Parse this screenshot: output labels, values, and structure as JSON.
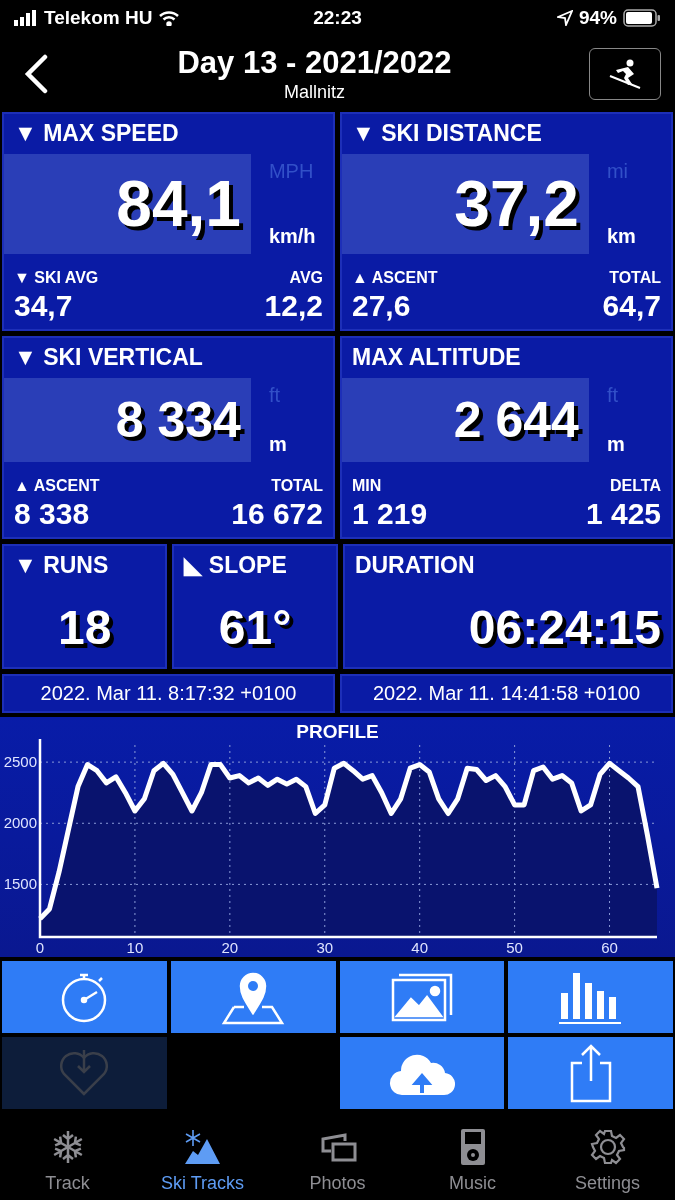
{
  "status_bar": {
    "carrier": "Telekom HU",
    "time": "22:23",
    "battery": "94%"
  },
  "header": {
    "title": "Day 13 - 2021/2022",
    "subtitle": "Mallnitz"
  },
  "stat_rows": [
    {
      "panels": [
        {
          "kind": "big",
          "title": "▼ MAX SPEED",
          "value": "84,1",
          "alt_unit": "MPH",
          "unit": "km/h",
          "sub_left_label": "▼ SKI AVG",
          "sub_right_label": "AVG",
          "sub_left_value": "34,7",
          "sub_right_value": "12,2"
        },
        {
          "kind": "big",
          "title": "▼ SKI DISTANCE",
          "value": "37,2",
          "alt_unit": "mi",
          "unit": "km",
          "sub_left_label": "▲ ASCENT",
          "sub_right_label": "TOTAL",
          "sub_left_value": "27,6",
          "sub_right_value": "64,7"
        }
      ]
    },
    {
      "panels": [
        {
          "kind": "big",
          "title": "▼ SKI VERTICAL",
          "value": "8 334",
          "alt_unit": "ft",
          "unit": "m",
          "sub_left_label": "▲ ASCENT",
          "sub_right_label": "TOTAL",
          "sub_left_value": "8 338",
          "sub_right_value": "16 672"
        },
        {
          "kind": "big",
          "title": "MAX ALTITUDE",
          "value": "2 644",
          "alt_unit": "ft",
          "unit": "m",
          "sub_left_label": "MIN",
          "sub_right_label": "DELTA",
          "sub_left_value": "1 219",
          "sub_right_value": "1 425"
        }
      ]
    },
    {
      "panels": [
        {
          "kind": "center",
          "title": "▼ RUNS",
          "value": "18"
        },
        {
          "kind": "center",
          "title": "◣ SLOPE",
          "value": "61°"
        },
        {
          "kind": "right",
          "title": "DURATION",
          "value": "06:24:15"
        }
      ]
    }
  ],
  "times": [
    "2022. Mar 11. 8:17:32 +0100",
    "2022. Mar 11. 14:41:58 +0100"
  ],
  "profile": {
    "chart_data": {
      "type": "line",
      "title": "PROFILE",
      "grid": true,
      "xlim": [
        0,
        65
      ],
      "ylim": [
        1070,
        2640
      ],
      "xticks": [
        0,
        10,
        20,
        30,
        40,
        50,
        60
      ],
      "yticks": [
        1500,
        2000,
        2500
      ],
      "x": [
        0,
        1,
        2,
        3,
        4,
        5,
        6,
        7,
        8,
        9,
        10,
        11,
        12,
        13,
        14,
        15,
        16,
        17,
        18,
        19,
        20,
        21,
        22,
        23,
        24,
        25,
        26,
        27,
        28,
        29,
        30,
        31,
        32,
        33,
        34,
        35,
        36,
        37,
        38,
        39,
        40,
        41,
        42,
        43,
        44,
        45,
        46,
        47,
        48,
        49,
        50,
        51,
        52,
        53,
        54,
        55,
        56,
        57,
        58,
        59,
        60,
        61,
        62,
        63,
        64,
        65
      ],
      "series": [
        {
          "color": "#ffffff",
          "values": [
            1220,
            1300,
            1600,
            1950,
            2300,
            2480,
            2430,
            2330,
            2380,
            2250,
            2100,
            2200,
            2430,
            2490,
            2400,
            2250,
            2100,
            2250,
            2480,
            2480,
            2370,
            2390,
            2330,
            2370,
            2310,
            2360,
            2320,
            2360,
            2300,
            2080,
            2150,
            2450,
            2490,
            2430,
            2360,
            2390,
            2250,
            2080,
            2200,
            2450,
            2480,
            2420,
            2200,
            2080,
            2200,
            2450,
            2440,
            2350,
            2390,
            2300,
            2150,
            2150,
            2430,
            2460,
            2360,
            2390,
            2330,
            2100,
            2150,
            2400,
            2490,
            2430,
            2370,
            2300,
            1900,
            1470
          ]
        }
      ]
    }
  },
  "action_rows": [
    {
      "left": [
        {
          "kind": "stopwatch",
          "disabled": false
        },
        {
          "kind": "map",
          "disabled": false
        }
      ],
      "right": [
        {
          "kind": "photos",
          "disabled": false
        },
        {
          "kind": "stats",
          "disabled": false
        }
      ]
    },
    {
      "left": [
        {
          "kind": "favorite",
          "disabled": true
        }
      ],
      "right": [
        {
          "kind": "upload",
          "disabled": false
        },
        {
          "kind": "share",
          "disabled": false
        }
      ]
    }
  ],
  "tabs": [
    {
      "label": "Track",
      "selected": false
    },
    {
      "label": "Ski Tracks",
      "selected": true
    },
    {
      "label": "Photos",
      "selected": false
    },
    {
      "label": "Music",
      "selected": false
    },
    {
      "label": "Settings",
      "selected": false
    }
  ]
}
